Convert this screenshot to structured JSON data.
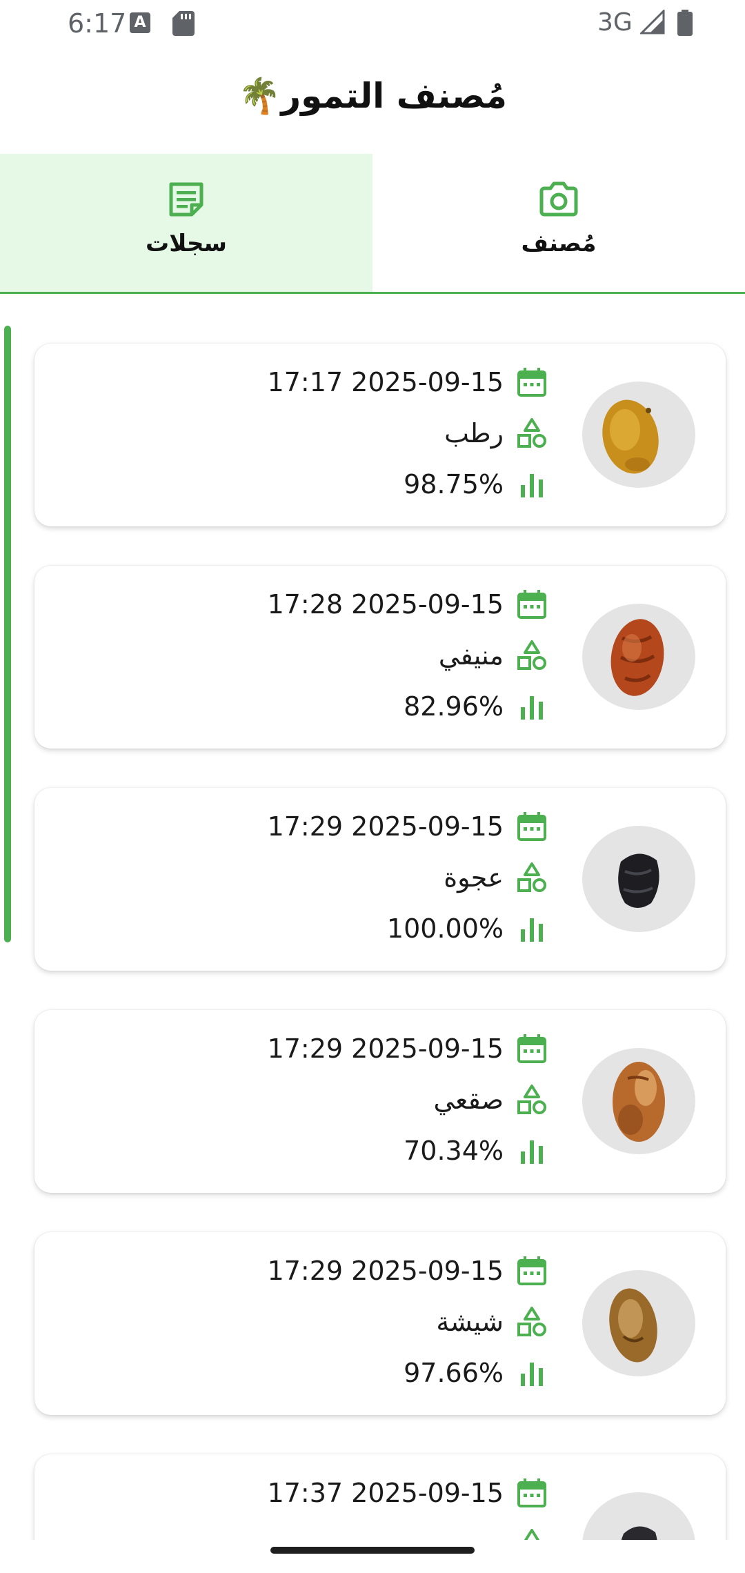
{
  "status_bar": {
    "time": "6:17",
    "a_badge": "A",
    "network": "3G"
  },
  "app": {
    "title": "مُصنف التمور🌴"
  },
  "tabs": [
    {
      "label": "سجلات",
      "icon": "notes-icon",
      "active": true
    },
    {
      "label": "مُصنف",
      "icon": "camera-icon",
      "active": false
    }
  ],
  "colors": {
    "accent": "#4caf50",
    "active_tab_bg": "#e5f9e6"
  },
  "records": [
    {
      "datetime": "17:17 2025-09-15",
      "type": "رطب",
      "confidence": "98.75%",
      "thumbnail": "ruteb-date"
    },
    {
      "datetime": "17:28 2025-09-15",
      "type": "منيفي",
      "confidence": "82.96%",
      "thumbnail": "munifi-date"
    },
    {
      "datetime": "17:29 2025-09-15",
      "type": "عجوة",
      "confidence": "100.00%",
      "thumbnail": "ajwa-date"
    },
    {
      "datetime": "17:29 2025-09-15",
      "type": "صقعي",
      "confidence": "70.34%",
      "thumbnail": "saqai-date"
    },
    {
      "datetime": "17:29 2025-09-15",
      "type": "شيشة",
      "confidence": "97.66%",
      "thumbnail": "shishah-date"
    },
    {
      "datetime": "17:37 2025-09-15",
      "type": "",
      "confidence": "",
      "thumbnail": "dark-date"
    }
  ]
}
